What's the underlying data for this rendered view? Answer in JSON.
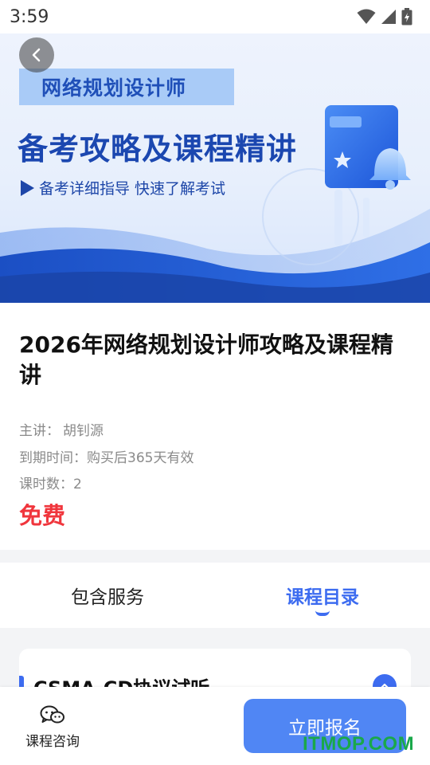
{
  "status_bar": {
    "time": "3:59",
    "icons": [
      "wifi-icon",
      "cellular-signal-icon",
      "battery-charging-icon"
    ]
  },
  "banner": {
    "tag": "网络规划设计师",
    "headline": "备考攻略及课程精讲",
    "subheadline": "备考详细指导 快速了解考试",
    "colors": {
      "primary": "#1b47b0",
      "tag_bg": "#a9cbf7"
    }
  },
  "course": {
    "title": "2026年网络规划设计师攻略及课程精讲",
    "lecturer_label": "主讲：",
    "lecturer": "胡钊源",
    "expiry_label": "到期时间：",
    "expiry": "购买后365天有效",
    "lessons_label": "课时数：",
    "lessons": "2",
    "price": "免费"
  },
  "tabs": [
    {
      "label": "包含服务",
      "active": false
    },
    {
      "label": "课程目录",
      "active": true
    }
  ],
  "chapter": {
    "title": "CSMA-CD协议试听"
  },
  "bottom_bar": {
    "consult_label": "课程咨询",
    "enroll_label": "立即报名"
  },
  "watermark": "ITMOP.COM",
  "colors": {
    "accent": "#3d6cf0",
    "enroll_button": "#5086f4",
    "price": "#f0363d"
  }
}
